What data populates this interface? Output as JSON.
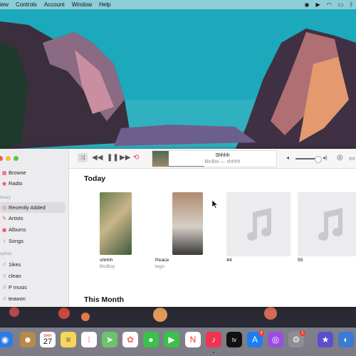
{
  "menubar": {
    "items": [
      "iew",
      "Controls",
      "Account",
      "Window",
      "Help"
    ]
  },
  "window": {
    "sidebar": {
      "section_library": "ibrary",
      "section_playlists": "aylists",
      "top_items": [
        {
          "label": "Browse",
          "icon": "browse-icon"
        },
        {
          "label": "Radio",
          "icon": "radio-icon"
        }
      ],
      "library_items": [
        {
          "label": "Recently Added",
          "icon": "recently-added-icon",
          "active": true
        },
        {
          "label": "Artists",
          "icon": "artists-icon"
        },
        {
          "label": "Albums",
          "icon": "albums-icon"
        },
        {
          "label": "Songs",
          "icon": "songs-icon"
        }
      ],
      "playlists": [
        {
          "label": "1ikes"
        },
        {
          "label": "clean"
        },
        {
          "label": "P music"
        },
        {
          "label": "teawon"
        }
      ]
    },
    "now_playing": {
      "title": "Shhhh",
      "subtitle": "BicBoi — shhhh",
      "progress": 0.33
    },
    "volume": 0.85,
    "sections": {
      "today": "Today",
      "this_month": "This Month"
    },
    "albums": [
      {
        "title": "shhhh",
        "artist": "BicBoy",
        "art": "photo"
      },
      {
        "title": "Peace",
        "artist": "lego",
        "art": "photo"
      },
      {
        "title": "44",
        "artist": "",
        "art": "placeholder"
      },
      {
        "title": "55",
        "artist": "",
        "art": "placeholder"
      }
    ]
  },
  "dock": {
    "badges": {
      "app_store": "9",
      "settings": "1"
    },
    "calendar": {
      "month": "MAR",
      "day": "27"
    }
  },
  "colors": {
    "accent": "#f23350",
    "sidebar_bg": "#ececef",
    "placeholder_art": "#ececee"
  }
}
